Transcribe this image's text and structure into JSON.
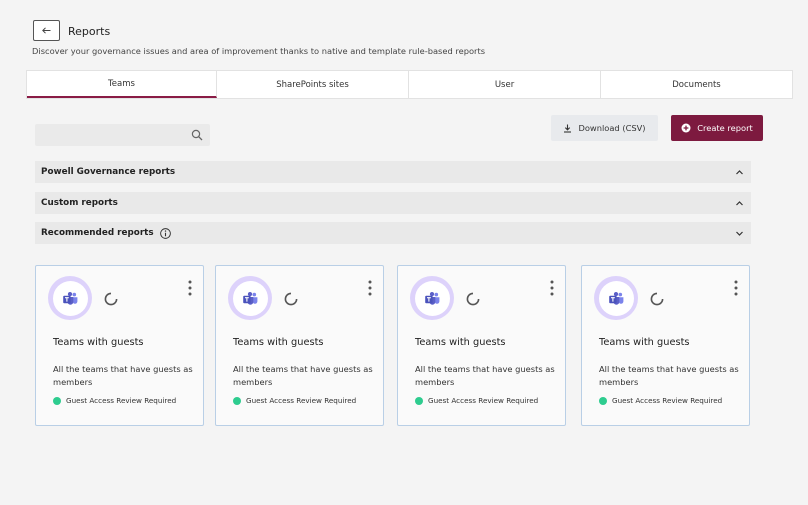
{
  "header": {
    "back_icon": "arrow-left-icon",
    "title": "Reports",
    "subtitle": "Discover your governance issues and area of improvement thanks to native and template rule-based reports"
  },
  "tabs": [
    {
      "label": "Teams",
      "active": true
    },
    {
      "label": "SharePoints sites",
      "active": false
    },
    {
      "label": "User",
      "active": false
    },
    {
      "label": "Documents",
      "active": false
    }
  ],
  "search": {
    "value": "",
    "placeholder": "",
    "icon": "search-icon"
  },
  "actions": {
    "download_label": "Download (CSV)",
    "download_icon": "download-icon",
    "create_label": "Create report",
    "create_icon": "plus-circle-icon"
  },
  "sections": [
    {
      "title": "Powell Governance reports",
      "expanded": true,
      "info": false
    },
    {
      "title": "Custom reports",
      "expanded": true,
      "info": false
    },
    {
      "title": "Recommended reports",
      "expanded": false,
      "info": true
    }
  ],
  "cards": [
    {
      "title": "Teams with guests",
      "description": "All the teams that have guests as members",
      "status": "Guest Access Review Required",
      "icon": "teams-icon"
    },
    {
      "title": "Teams with guests",
      "description": "All the teams that have guests as members",
      "status": "Guest Access Review Required",
      "icon": "teams-icon"
    },
    {
      "title": "Teams with guests",
      "description": "All the teams that have guests as members",
      "status": "Guest Access Review Required",
      "icon": "teams-icon"
    },
    {
      "title": "Teams with guests",
      "description": "All the teams that have guests as members",
      "status": "Guest Access Review Required",
      "icon": "teams-icon"
    }
  ],
  "colors": {
    "accent": "#7d1a3f",
    "status_green": "#2ecc8f",
    "card_border": "#b9cfe6",
    "icon_ring": "#ddd2fb",
    "teams_purple": "#5b5fc7"
  }
}
